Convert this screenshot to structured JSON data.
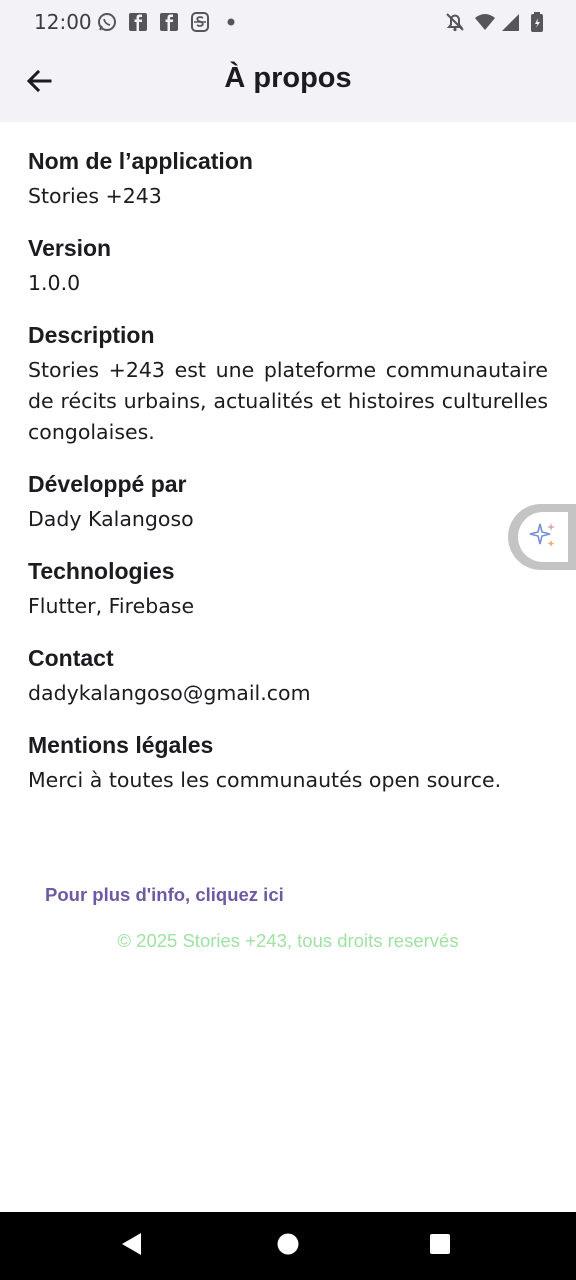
{
  "status_bar": {
    "time": "12:00",
    "left_icons": [
      "whatsapp-icon",
      "facebook-icon",
      "facebook-icon",
      "app-s-icon",
      "dot-icon"
    ],
    "right_icons": [
      "notifications-off-icon",
      "wifi-icon",
      "signal-icon",
      "battery-icon"
    ]
  },
  "app_bar": {
    "title": "À propos",
    "back_icon": "arrow-back-icon"
  },
  "sections": [
    {
      "title": "Nom de l’application",
      "value": "Stories +243"
    },
    {
      "title": "Version",
      "value": "1.0.0"
    },
    {
      "title": "Description",
      "value": "Stories +243 est une plateforme communautaire de récits urbains, actualités et histoires culturelles congolaises."
    },
    {
      "title": "Développé par",
      "value": "Dady Kalangoso"
    },
    {
      "title": "Technologies",
      "value": "Flutter, Firebase"
    },
    {
      "title": "Contact",
      "value": "dadykalangoso@gmail.com"
    },
    {
      "title": "Mentions légales",
      "value": "Merci à toutes les communautés open source."
    }
  ],
  "footer": {
    "more_info_link": "Pour plus d'info, cliquez ici",
    "copyright": "© 2025 Stories +243, tous droits reservés"
  },
  "colors": {
    "app_bar_bg": "#f3f2f7",
    "link": "#6e5aa4",
    "copyright": "#9fe2a2",
    "nav_bar_bg": "#000000"
  },
  "floating_assistant": {
    "icon": "sparkle-icon"
  },
  "nav_bar": {
    "buttons": [
      "back-triangle-icon",
      "home-circle-icon",
      "recents-square-icon"
    ]
  }
}
